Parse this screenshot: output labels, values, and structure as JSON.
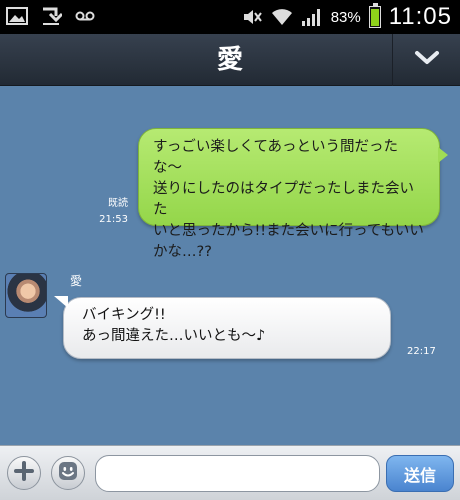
{
  "status_bar": {
    "battery_percent": "83%",
    "time": "11:05",
    "battery_level": 0.83,
    "icons": [
      "image-icon",
      "download-icon",
      "voicemail-icon",
      "mute-icon",
      "wifi-icon",
      "signal-icon",
      "battery-icon"
    ]
  },
  "header": {
    "title": "愛",
    "collapse_icon": "chevron-down-icon"
  },
  "messages": [
    {
      "from": "me",
      "lines": [
        "すっごい楽しくてあっという間だったな〜",
        "送りにしたのはタイプだったしまた会いた",
        "いと思ったから!!また会いに行ってもいい",
        "かな…??"
      ],
      "read": "既読",
      "time": "21:53"
    },
    {
      "from": "other",
      "sender": "愛",
      "lines": [
        "バイキング!!",
        "あっ間違えた…いいとも〜♪"
      ],
      "time": "22:17"
    }
  ],
  "input_bar": {
    "add_icon": "plus-icon",
    "sticker_icon": "smiley-icon",
    "input_value": "",
    "send_label": "送信"
  },
  "colors": {
    "chat_background": "#5b83ab",
    "my_bubble": "#a0dc55",
    "other_bubble": "#ffffff",
    "header": "#2b333e",
    "send_button": "#5a93db"
  }
}
